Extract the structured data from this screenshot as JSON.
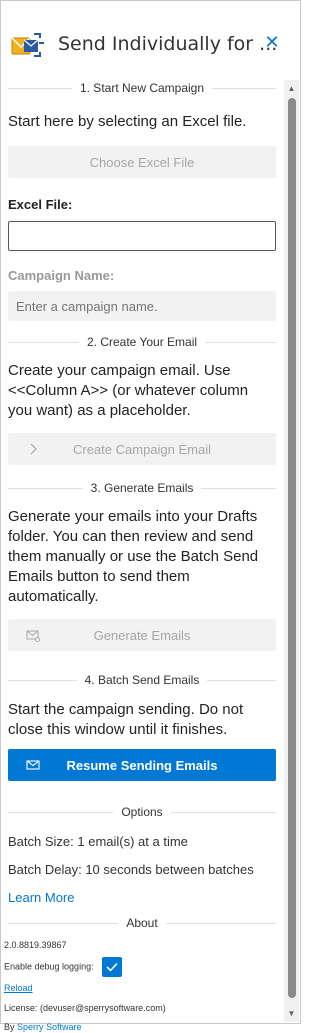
{
  "header": {
    "title": "Send Individually for ...",
    "close_icon": "close-icon"
  },
  "section1": {
    "title": "1. Start New Campaign",
    "intro": "Start here by selecting an Excel file.",
    "choose_button": "Choose Excel File",
    "excel_file_label": "Excel File:",
    "excel_file_value": "",
    "campaign_name_label": "Campaign Name:",
    "campaign_name_placeholder": "Enter a campaign name."
  },
  "section2": {
    "title": "2. Create Your Email",
    "intro": "Create your campaign email. Use <<Column A>> (or whatever column you want) as a placeholder.",
    "create_button": "Create Campaign Email"
  },
  "section3": {
    "title": "3. Generate Emails",
    "intro": "Generate your emails into your Drafts folder. You can then review and send them manually or use the Batch Send Emails button to send them automatically.",
    "generate_button": "Generate Emails"
  },
  "section4": {
    "title": "4. Batch Send Emails",
    "intro": "Start the campaign sending. Do not close this window until it finishes.",
    "resume_button": "Resume Sending Emails"
  },
  "options": {
    "title": "Options",
    "batch_size": "Batch Size: 1 email(s) at a time",
    "batch_delay": "Batch Delay: 10 seconds between batches",
    "learn_more": "Learn More"
  },
  "about": {
    "title": "About",
    "version": "2.0.8819.39867",
    "debug_label": "Enable debug logging:",
    "debug_checked": true,
    "reload": "Reload",
    "license": "License: (devuser@sperrysoftware.com)",
    "by_prefix": "By",
    "by_link": "Sperry Software"
  },
  "colors": {
    "accent": "#0078d4",
    "disabled_bg": "#f2f2f2",
    "disabled_text": "#a6a6a6"
  }
}
